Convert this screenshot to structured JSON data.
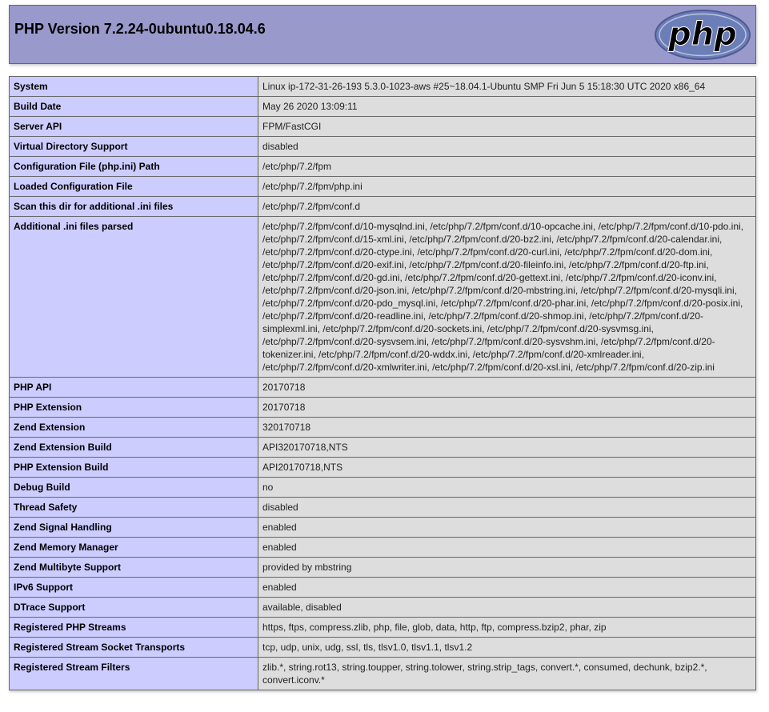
{
  "header": {
    "title": "PHP Version 7.2.24-0ubuntu0.18.04.6",
    "logo_text": "php"
  },
  "colors": {
    "header_bg": "#9999cc",
    "key_cell_bg": "#ccccff",
    "value_cell_bg": "#dddddd",
    "border": "#666666",
    "logo_bg": "#6c7eb7"
  },
  "rows": [
    {
      "key": "System",
      "value": "Linux ip-172-31-26-193 5.3.0-1023-aws #25~18.04.1-Ubuntu SMP Fri Jun 5 15:18:30 UTC 2020 x86_64"
    },
    {
      "key": "Build Date",
      "value": "May 26 2020 13:09:11"
    },
    {
      "key": "Server API",
      "value": "FPM/FastCGI"
    },
    {
      "key": "Virtual Directory Support",
      "value": "disabled"
    },
    {
      "key": "Configuration File (php.ini) Path",
      "value": "/etc/php/7.2/fpm"
    },
    {
      "key": "Loaded Configuration File",
      "value": "/etc/php/7.2/fpm/php.ini"
    },
    {
      "key": "Scan this dir for additional .ini files",
      "value": "/etc/php/7.2/fpm/conf.d"
    },
    {
      "key": "Additional .ini files parsed",
      "value": "/etc/php/7.2/fpm/conf.d/10-mysqlnd.ini, /etc/php/7.2/fpm/conf.d/10-opcache.ini, /etc/php/7.2/fpm/conf.d/10-pdo.ini, /etc/php/7.2/fpm/conf.d/15-xml.ini, /etc/php/7.2/fpm/conf.d/20-bz2.ini, /etc/php/7.2/fpm/conf.d/20-calendar.ini, /etc/php/7.2/fpm/conf.d/20-ctype.ini, /etc/php/7.2/fpm/conf.d/20-curl.ini, /etc/php/7.2/fpm/conf.d/20-dom.ini, /etc/php/7.2/fpm/conf.d/20-exif.ini, /etc/php/7.2/fpm/conf.d/20-fileinfo.ini, /etc/php/7.2/fpm/conf.d/20-ftp.ini, /etc/php/7.2/fpm/conf.d/20-gd.ini, /etc/php/7.2/fpm/conf.d/20-gettext.ini, /etc/php/7.2/fpm/conf.d/20-iconv.ini, /etc/php/7.2/fpm/conf.d/20-json.ini, /etc/php/7.2/fpm/conf.d/20-mbstring.ini, /etc/php/7.2/fpm/conf.d/20-mysqli.ini, /etc/php/7.2/fpm/conf.d/20-pdo_mysql.ini, /etc/php/7.2/fpm/conf.d/20-phar.ini, /etc/php/7.2/fpm/conf.d/20-posix.ini, /etc/php/7.2/fpm/conf.d/20-readline.ini, /etc/php/7.2/fpm/conf.d/20-shmop.ini, /etc/php/7.2/fpm/conf.d/20-simplexml.ini, /etc/php/7.2/fpm/conf.d/20-sockets.ini, /etc/php/7.2/fpm/conf.d/20-sysvmsg.ini, /etc/php/7.2/fpm/conf.d/20-sysvsem.ini, /etc/php/7.2/fpm/conf.d/20-sysvshm.ini, /etc/php/7.2/fpm/conf.d/20-tokenizer.ini, /etc/php/7.2/fpm/conf.d/20-wddx.ini, /etc/php/7.2/fpm/conf.d/20-xmlreader.ini, /etc/php/7.2/fpm/conf.d/20-xmlwriter.ini, /etc/php/7.2/fpm/conf.d/20-xsl.ini, /etc/php/7.2/fpm/conf.d/20-zip.ini"
    },
    {
      "key": "PHP API",
      "value": "20170718"
    },
    {
      "key": "PHP Extension",
      "value": "20170718"
    },
    {
      "key": "Zend Extension",
      "value": "320170718"
    },
    {
      "key": "Zend Extension Build",
      "value": "API320170718,NTS"
    },
    {
      "key": "PHP Extension Build",
      "value": "API20170718,NTS"
    },
    {
      "key": "Debug Build",
      "value": "no"
    },
    {
      "key": "Thread Safety",
      "value": "disabled"
    },
    {
      "key": "Zend Signal Handling",
      "value": "enabled"
    },
    {
      "key": "Zend Memory Manager",
      "value": "enabled"
    },
    {
      "key": "Zend Multibyte Support",
      "value": "provided by mbstring"
    },
    {
      "key": "IPv6 Support",
      "value": "enabled"
    },
    {
      "key": "DTrace Support",
      "value": "available, disabled"
    },
    {
      "key": "Registered PHP Streams",
      "value": "https, ftps, compress.zlib, php, file, glob, data, http, ftp, compress.bzip2, phar, zip"
    },
    {
      "key": "Registered Stream Socket Transports",
      "value": "tcp, udp, unix, udg, ssl, tls, tlsv1.0, tlsv1.1, tlsv1.2"
    },
    {
      "key": "Registered Stream Filters",
      "value": "zlib.*, string.rot13, string.toupper, string.tolower, string.strip_tags, convert.*, consumed, dechunk, bzip2.*, convert.iconv.*"
    }
  ]
}
